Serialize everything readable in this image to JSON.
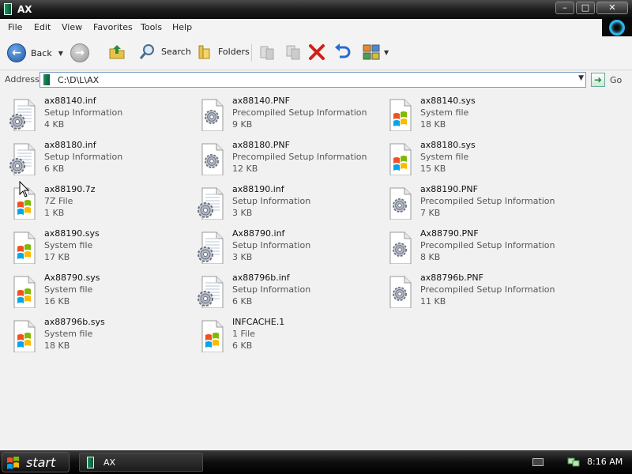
{
  "window": {
    "title": "AX",
    "minimize": "–",
    "maximize": "□",
    "close": "✕"
  },
  "menu": [
    "File",
    "Edit",
    "View",
    "Favorites",
    "Tools",
    "Help"
  ],
  "toolbar": {
    "back": "Back",
    "search": "Search",
    "folders": "Folders"
  },
  "address": {
    "label": "Address",
    "path": "C:\\D\\L\\AX",
    "go": "Go"
  },
  "files": [
    {
      "name": "ax88140.inf",
      "type": "Setup Information",
      "size": "4 KB",
      "icon": "setup-info-icon"
    },
    {
      "name": "ax88140.PNF",
      "type": "Precompiled Setup Information",
      "size": "9 KB",
      "icon": "pnf-icon"
    },
    {
      "name": "ax88140.sys",
      "type": "System file",
      "size": "18 KB",
      "icon": "system-file-icon"
    },
    {
      "name": "ax88180.inf",
      "type": "Setup Information",
      "size": "6 KB",
      "icon": "setup-info-icon"
    },
    {
      "name": "ax88180.PNF",
      "type": "Precompiled Setup Information",
      "size": "12 KB",
      "icon": "pnf-icon"
    },
    {
      "name": "ax88180.sys",
      "type": "System file",
      "size": "15 KB",
      "icon": "system-file-icon"
    },
    {
      "name": "ax88190.7z",
      "type": "7Z File",
      "size": "1 KB",
      "icon": "windows-file-icon"
    },
    {
      "name": "ax88190.inf",
      "type": "Setup Information",
      "size": "3 KB",
      "icon": "setup-info-icon"
    },
    {
      "name": "ax88190.PNF",
      "type": "Precompiled Setup Information",
      "size": "7 KB",
      "icon": "pnf-icon"
    },
    {
      "name": "ax88190.sys",
      "type": "System file",
      "size": "17 KB",
      "icon": "system-file-icon"
    },
    {
      "name": "Ax88790.inf",
      "type": "Setup Information",
      "size": "3 KB",
      "icon": "setup-info-icon"
    },
    {
      "name": "Ax88790.PNF",
      "type": "Precompiled Setup Information",
      "size": "8 KB",
      "icon": "pnf-icon"
    },
    {
      "name": "Ax88790.sys",
      "type": "System file",
      "size": "16 KB",
      "icon": "system-file-icon"
    },
    {
      "name": "ax88796b.inf",
      "type": "Setup Information",
      "size": "6 KB",
      "icon": "setup-info-icon"
    },
    {
      "name": "ax88796b.PNF",
      "type": "Precompiled Setup Information",
      "size": "11 KB",
      "icon": "pnf-icon"
    },
    {
      "name": "ax88796b.sys",
      "type": "System file",
      "size": "18 KB",
      "icon": "system-file-icon"
    },
    {
      "name": "INFCACHE.1",
      "type": "1 File",
      "size": "6 KB",
      "icon": "windows-file-icon"
    }
  ],
  "taskbar": {
    "start": "start",
    "task": "AX",
    "clock": "8:16 AM"
  }
}
